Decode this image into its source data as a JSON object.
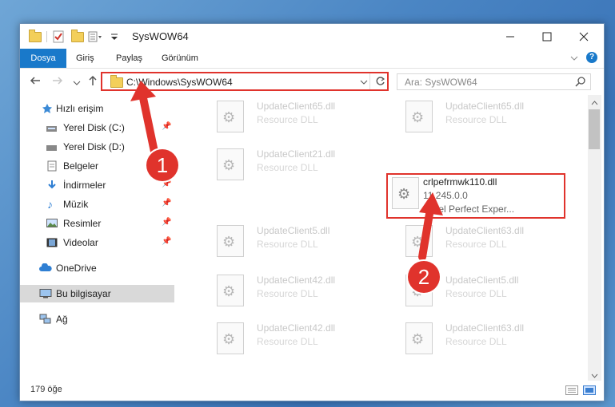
{
  "window": {
    "title": "SysWOW64",
    "minimize_icon": "minimize-icon",
    "maximize_icon": "maximize-icon",
    "close_icon": "close-icon"
  },
  "ribbon": {
    "tabs": [
      {
        "label": "Dosya"
      },
      {
        "label": "Giriş"
      },
      {
        "label": "Paylaş"
      },
      {
        "label": "Görünüm"
      }
    ],
    "accent": "#1979ca"
  },
  "nav": {
    "address": "C:\\Windows\\SysWOW64",
    "search_placeholder": "Ara: SysWOW64"
  },
  "sidebar": {
    "items": [
      {
        "label": "Hızlı erişim"
      },
      {
        "label": "Yerel Disk (C:)"
      },
      {
        "label": "Yerel Disk (D:)"
      },
      {
        "label": "Belgeler"
      },
      {
        "label": "İndirmeler"
      },
      {
        "label": "Müzik"
      },
      {
        "label": "Resimler"
      },
      {
        "label": "Videolar"
      },
      {
        "label": "OneDrive"
      },
      {
        "label": "Bu bilgisayar"
      },
      {
        "label": "Ağ"
      }
    ]
  },
  "files": [
    {
      "name": "UpdateClient65.dll",
      "desc": "Resource DLL"
    },
    {
      "name": "UpdateClient65.dll",
      "desc": "Resource DLL"
    },
    {
      "name": "UpdateClient21.dll",
      "desc": "Resource DLL"
    },
    {
      "name": "crlpefrmwk110.dll",
      "version": "11.245.0.0",
      "desc": "Corel Perfect Exper..."
    },
    {
      "name": "UpdateClient5.dll",
      "desc": "Resource DLL"
    },
    {
      "name": "UpdateClient63.dll",
      "desc": "Resource DLL"
    },
    {
      "name": "UpdateClient42.dll",
      "desc": "Resource DLL"
    },
    {
      "name": "UpdateClient5.dll",
      "desc": "Resource DLL"
    },
    {
      "name": "UpdateClient42.dll",
      "desc": "Resource DLL"
    },
    {
      "name": "UpdateClient63.dll",
      "desc": "Resource DLL"
    }
  ],
  "status": {
    "count": "179 öğe"
  },
  "callouts": [
    "1",
    "2"
  ],
  "highlight_color": "#e0332c"
}
